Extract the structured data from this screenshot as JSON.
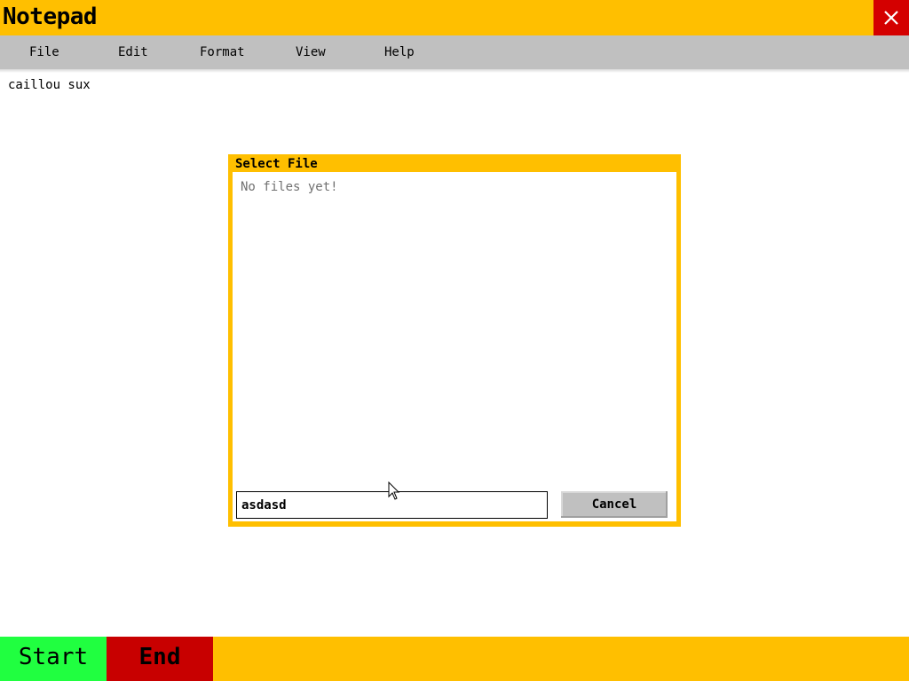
{
  "window": {
    "title": "Notepad",
    "close_icon": "close-icon",
    "accent_color": "#ffbf00",
    "close_color": "#d40000"
  },
  "menu": {
    "items": [
      {
        "label": "File"
      },
      {
        "label": "Edit"
      },
      {
        "label": "Format"
      },
      {
        "label": "View"
      },
      {
        "label": "Help"
      }
    ]
  },
  "document": {
    "text": "caillou sux"
  },
  "dialog": {
    "title": "Select File",
    "empty_message": "No files yet!",
    "filename_value": "asdasd",
    "cancel_label": "Cancel"
  },
  "taskbar": {
    "start_label": "Start",
    "end_label": "End",
    "start_color": "#20ff40",
    "end_color": "#c80000"
  },
  "pointer_icon": "arrow-cursor-icon"
}
